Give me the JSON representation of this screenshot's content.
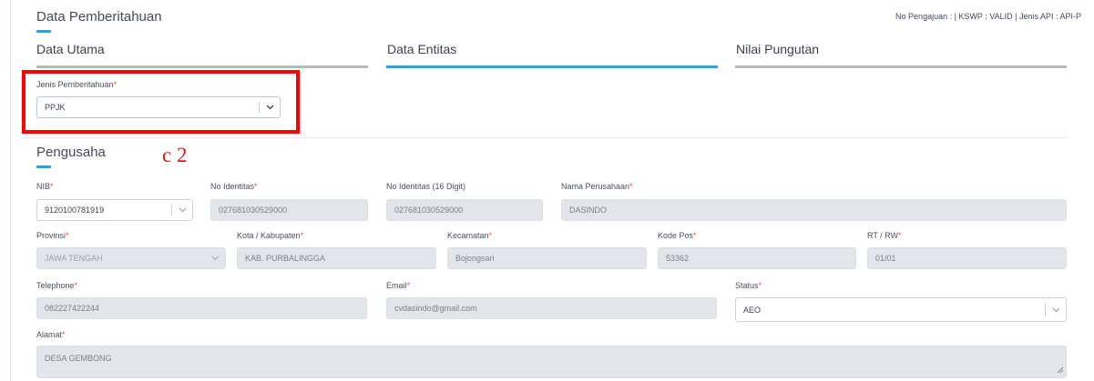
{
  "header": {
    "title": "Data Pemberitahuan",
    "meta": "No Pengajuan : | KSWP : VALID | Jenis API : API-P"
  },
  "tabs": [
    {
      "label": "Data Utama"
    },
    {
      "label": "Data Entitas"
    },
    {
      "label": "Nilai Pungutan"
    }
  ],
  "jenis": {
    "label": "Jenis Pemberitahuan",
    "value": "PPJK"
  },
  "annotation": "c 2",
  "section": {
    "title": "Pengusaha"
  },
  "fields": {
    "nib": {
      "label": "NIB",
      "value": "9120100781919"
    },
    "no_identitas": {
      "label": "No Identitas",
      "value": "027681030529000"
    },
    "no_identitas16": {
      "label": "No Identitas (16 Digit)",
      "value": "027681030529000"
    },
    "nama": {
      "label": "Nama Perusahaan",
      "value": "DASINDO"
    },
    "provinsi": {
      "label": "Provinsi",
      "value": "JAWA TENGAH"
    },
    "kota": {
      "label": "Kota / Kabupaten",
      "value": "KAB. PURBALINGGA"
    },
    "kecamatan": {
      "label": "Kecamatan",
      "value": "Bojongsari"
    },
    "kodepos": {
      "label": "Kode Pos",
      "value": "53362"
    },
    "rtrw": {
      "label": "RT / RW",
      "value": "01/01"
    },
    "telephone": {
      "label": "Telephone",
      "value": "082227422244"
    },
    "email": {
      "label": "Email",
      "value": "cvdasindo@gmail.com"
    },
    "status": {
      "label": "Status",
      "value": "AEO"
    },
    "alamat": {
      "label": "Alamat",
      "value": "DESA GEMBONG"
    }
  },
  "required_marker": "*",
  "colors": {
    "accent": "#22a7d8",
    "annotation": "#ff0000",
    "required": "#e8534f"
  }
}
